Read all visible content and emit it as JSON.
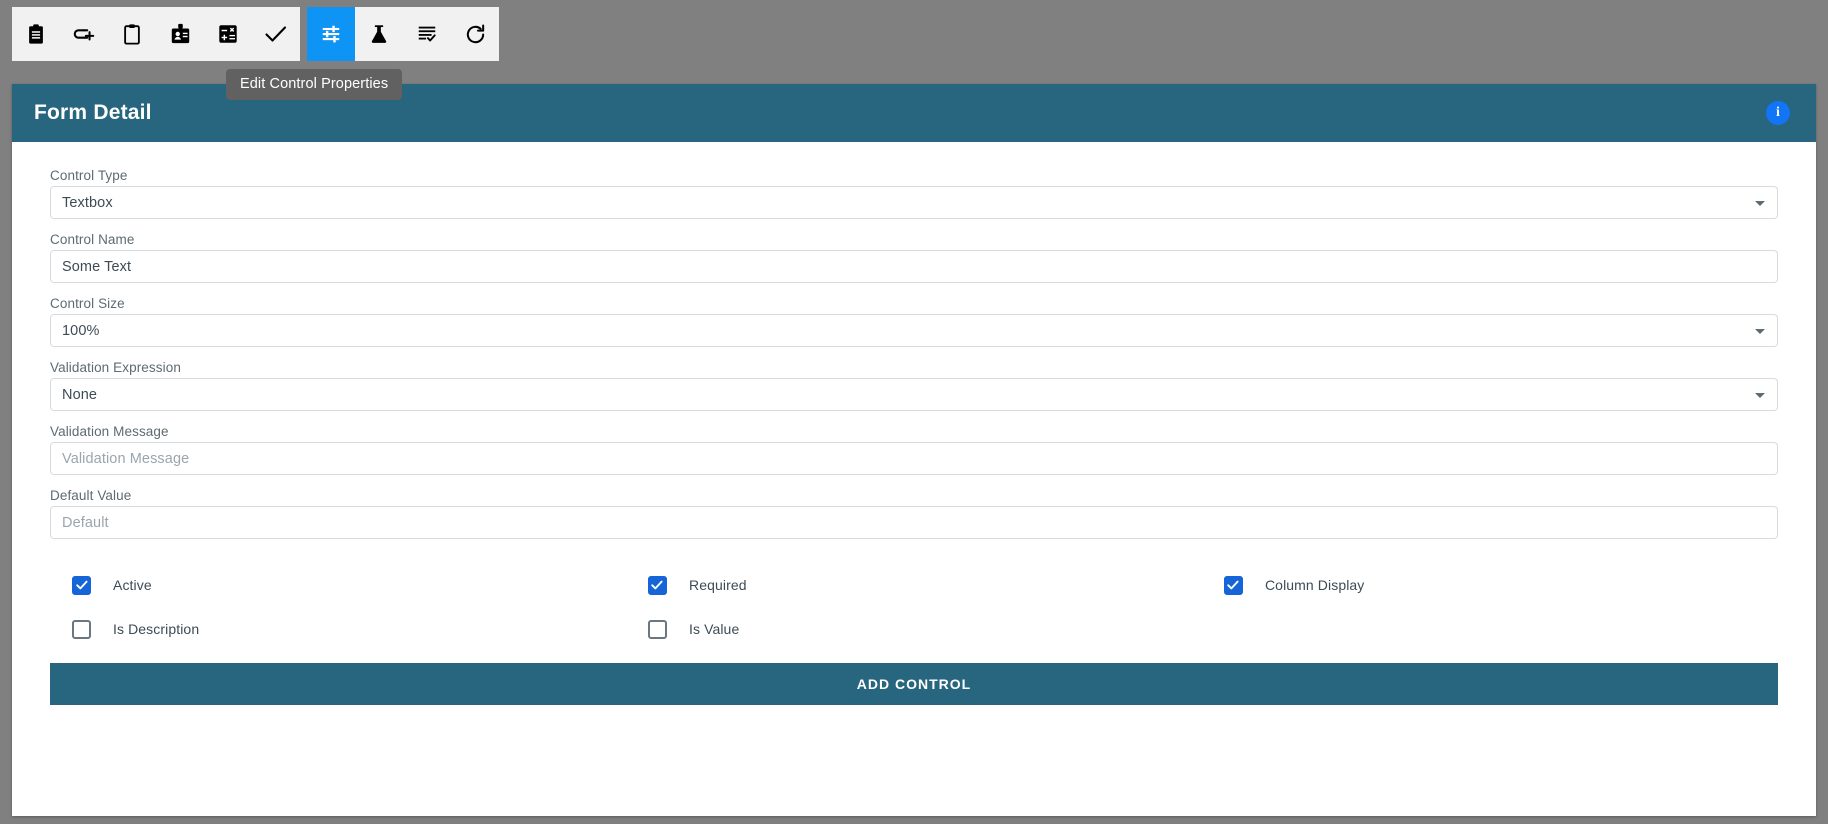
{
  "toolbar": {
    "groups": [
      {
        "name": "document-actions",
        "buttons": [
          {
            "icon": "clipboard-list-icon",
            "label": "Clipboard List",
            "active": false
          },
          {
            "icon": "link-add-icon",
            "label": "Add Link",
            "active": false
          },
          {
            "icon": "clipboard-blank-icon",
            "label": "Clipboard",
            "active": false
          },
          {
            "icon": "id-badge-icon",
            "label": "Id Badge",
            "active": false
          },
          {
            "icon": "calculator-icon",
            "label": "Calculator",
            "active": false
          },
          {
            "icon": "check-icon",
            "label": "Check",
            "active": false
          }
        ]
      },
      {
        "name": "properties-actions",
        "buttons": [
          {
            "icon": "sliders-icon",
            "label": "Edit Control Properties",
            "active": true
          },
          {
            "icon": "flask-icon",
            "label": "Test",
            "active": false
          },
          {
            "icon": "list-check-icon",
            "label": "Validate List",
            "active": false
          },
          {
            "icon": "refresh-icon",
            "label": "Refresh",
            "active": false
          }
        ]
      }
    ]
  },
  "tooltip": {
    "text": "Edit Control Properties"
  },
  "card": {
    "title": "Form Detail",
    "info_badge": "i"
  },
  "form": {
    "fields": [
      {
        "name": "control-type",
        "label": "Control Type",
        "value": "Textbox",
        "placeholder": "",
        "type": "select"
      },
      {
        "name": "control-name",
        "label": "Control Name",
        "value": "Some Text",
        "placeholder": "",
        "type": "text"
      },
      {
        "name": "control-size",
        "label": "Control Size",
        "value": "100%",
        "placeholder": "",
        "type": "select"
      },
      {
        "name": "validation-expression",
        "label": "Validation Expression",
        "value": "None",
        "placeholder": "",
        "type": "select"
      },
      {
        "name": "validation-message",
        "label": "Validation Message",
        "value": "",
        "placeholder": "Validation Message",
        "type": "text"
      },
      {
        "name": "default-value",
        "label": "Default Value",
        "value": "",
        "placeholder": "Default",
        "type": "text"
      }
    ],
    "checkbox_rows": [
      [
        {
          "name": "active",
          "label": "Active",
          "checked": true
        },
        {
          "name": "required",
          "label": "Required",
          "checked": true
        },
        {
          "name": "column-display",
          "label": "Column Display",
          "checked": true
        }
      ],
      [
        {
          "name": "is-description",
          "label": "Is Description",
          "checked": false
        },
        {
          "name": "is-value",
          "label": "Is Value",
          "checked": false
        },
        {
          "name": "",
          "label": "",
          "checked": null
        }
      ]
    ],
    "submit_label": "ADD CONTROL"
  },
  "colors": {
    "header": "#28657f",
    "active_toolbar": "#0d94f4",
    "checkbox_checked": "#1565d8",
    "info_badge": "#1175f5",
    "page_background": "#808080",
    "tooltip_background": "#616161"
  }
}
